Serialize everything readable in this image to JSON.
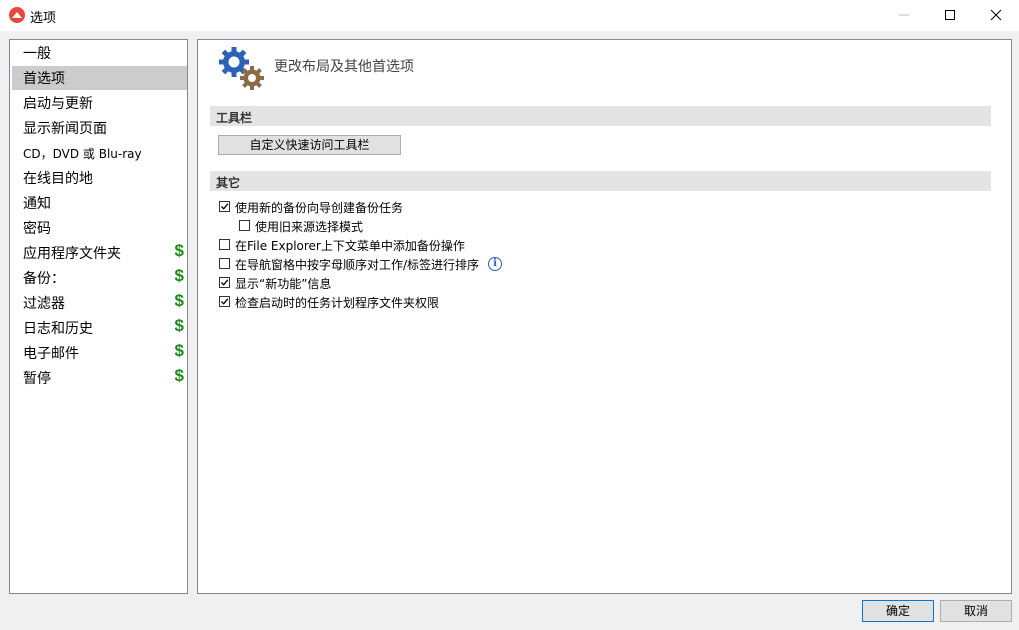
{
  "window": {
    "title": "选项"
  },
  "sidebar": {
    "items": [
      {
        "label": "一般",
        "selected": false,
        "paid": false
      },
      {
        "label": "首选项",
        "selected": true,
        "paid": false
      },
      {
        "label": "启动与更新",
        "selected": false,
        "paid": false
      },
      {
        "label": "显示新闻页面",
        "selected": false,
        "paid": false
      },
      {
        "label": "CD，DVD 或 Blu-ray",
        "selected": false,
        "paid": false
      },
      {
        "label": "在线目的地",
        "selected": false,
        "paid": false
      },
      {
        "label": "通知",
        "selected": false,
        "paid": false
      },
      {
        "label": "密码",
        "selected": false,
        "paid": false
      },
      {
        "label": "应用程序文件夹",
        "selected": false,
        "paid": true
      },
      {
        "label": "备份：",
        "selected": false,
        "paid": true
      },
      {
        "label": "过滤器",
        "selected": false,
        "paid": true
      },
      {
        "label": "日志和历史",
        "selected": false,
        "paid": true
      },
      {
        "label": "电子邮件",
        "selected": false,
        "paid": true
      },
      {
        "label": "暂停",
        "selected": false,
        "paid": true
      }
    ],
    "paid_symbol": "$"
  },
  "main": {
    "heading": "更改布局及其他首选项",
    "toolbar_section": {
      "label": "工具栏",
      "button_label": "自定义快速访问工具栏"
    },
    "other_section": {
      "label": "其它",
      "options": [
        {
          "label": "使用新的备份向导创建备份任务",
          "checked": true
        },
        {
          "label": "使用旧来源选择模式",
          "checked": false
        },
        {
          "label": "在File Explorer上下文菜单中添加备份操作",
          "checked": false
        },
        {
          "label": "在导航窗格中按字母顺序对工作/标签进行排序",
          "checked": false
        },
        {
          "label": "显示“新功能”信息",
          "checked": true
        },
        {
          "label": "检查启动时的任务计划程序文件夹权限",
          "checked": true
        }
      ],
      "info_symbol": "i"
    }
  },
  "buttons": {
    "ok": "确定",
    "cancel": "取消"
  },
  "colors": {
    "paid": "#1e8a1e",
    "selected_row": "#cccccc",
    "gear_blue": "#2a62b8",
    "gear_brown": "#8b6a44"
  }
}
